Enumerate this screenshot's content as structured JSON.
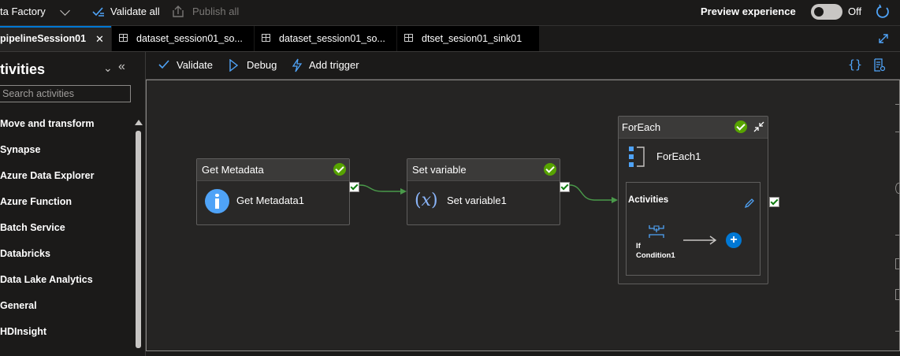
{
  "topbar": {
    "app_title": "ta Factory",
    "validate_all": "Validate all",
    "publish_all": "Publish all",
    "preview_label": "Preview experience",
    "preview_state": "Off"
  },
  "tabs": [
    {
      "label": "pipelineSession01",
      "close": "✕"
    },
    {
      "label": "dataset_session01_so..."
    },
    {
      "label": "dataset_session01_so..."
    },
    {
      "label": "dtset_sesion01_sink01"
    }
  ],
  "activities_panel": {
    "title": "tivities",
    "search_placeholder": "Search activities",
    "categories": [
      "Move and transform",
      "Synapse",
      "Azure Data Explorer",
      "Azure Function",
      "Batch Service",
      "Databricks",
      "Data Lake Analytics",
      "General",
      "HDInsight"
    ]
  },
  "toolbar": {
    "validate": "Validate",
    "debug": "Debug",
    "add_trigger": "Add trigger"
  },
  "canvas": {
    "get_metadata": {
      "header": "Get Metadata",
      "name": "Get Metadata1"
    },
    "set_variable": {
      "header": "Set variable",
      "name": "Set variable1",
      "icon_glyph": "(𝑥)"
    },
    "foreach": {
      "header": "ForEach",
      "name": "ForEach1",
      "inner_title": "Activities",
      "inner_activity_line1": "If",
      "inner_activity_line2": "Condition1"
    }
  },
  "colors": {
    "accent": "#0078d4",
    "success": "#57a300",
    "link": "#4fa3f7"
  }
}
